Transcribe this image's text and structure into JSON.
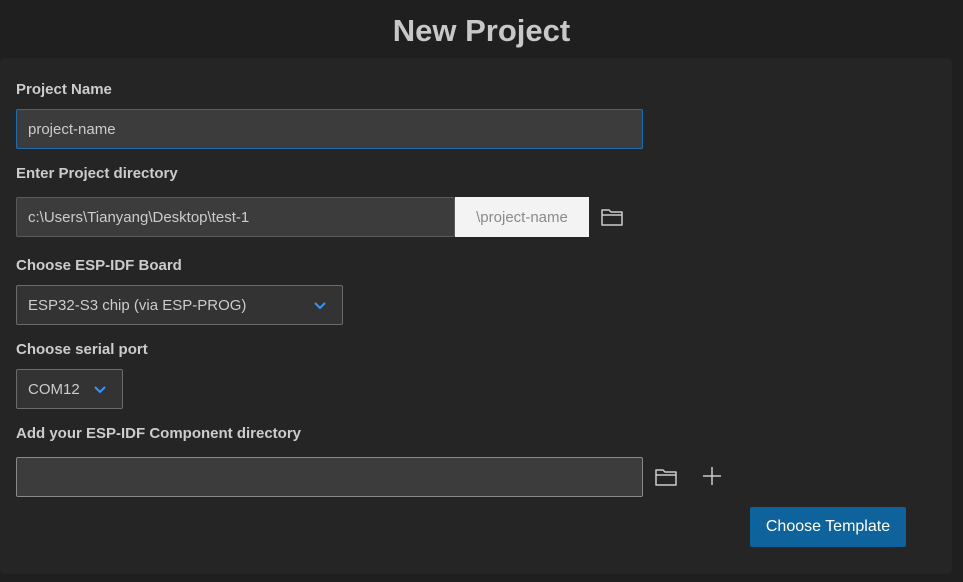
{
  "page": {
    "title": "New Project"
  },
  "project_name": {
    "label": "Project Name",
    "value": "project-name"
  },
  "project_directory": {
    "label": "Enter Project directory",
    "value": "c:\\Users\\Tianyang\\Desktop\\test-1",
    "suffix": "\\project-name",
    "browse_icon": "folder-icon"
  },
  "board": {
    "label": "Choose ESP-IDF Board",
    "selected": "ESP32-S3 chip (via ESP-PROG)",
    "icon": "chevron-down-icon"
  },
  "serial_port": {
    "label": "Choose serial port",
    "selected": "COM12",
    "icon": "chevron-down-icon"
  },
  "component_directory": {
    "label": "Add your ESP-IDF Component directory",
    "value": "",
    "browse_icon": "folder-icon",
    "add_icon": "plus-icon"
  },
  "actions": {
    "choose_template_label": "Choose Template"
  },
  "colors": {
    "accent": "#0e639c",
    "focus_border": "#1f6fb0",
    "chevron": "#3794ff"
  }
}
